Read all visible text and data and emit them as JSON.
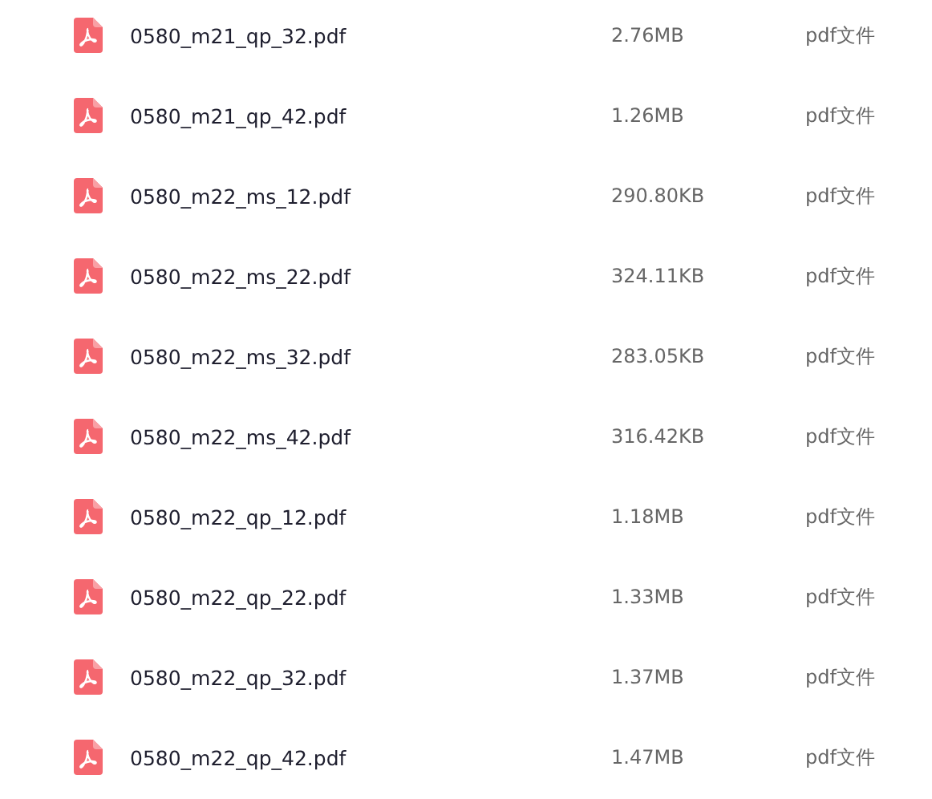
{
  "files": [
    {
      "name": "0580_m21_qp_32.pdf",
      "size": "2.76MB",
      "type": "pdf文件"
    },
    {
      "name": "0580_m21_qp_42.pdf",
      "size": "1.26MB",
      "type": "pdf文件"
    },
    {
      "name": "0580_m22_ms_12.pdf",
      "size": "290.80KB",
      "type": "pdf文件"
    },
    {
      "name": "0580_m22_ms_22.pdf",
      "size": "324.11KB",
      "type": "pdf文件"
    },
    {
      "name": "0580_m22_ms_32.pdf",
      "size": "283.05KB",
      "type": "pdf文件"
    },
    {
      "name": "0580_m22_ms_42.pdf",
      "size": "316.42KB",
      "type": "pdf文件"
    },
    {
      "name": "0580_m22_qp_12.pdf",
      "size": "1.18MB",
      "type": "pdf文件"
    },
    {
      "name": "0580_m22_qp_22.pdf",
      "size": "1.33MB",
      "type": "pdf文件"
    },
    {
      "name": "0580_m22_qp_32.pdf",
      "size": "1.37MB",
      "type": "pdf文件"
    },
    {
      "name": "0580_m22_qp_42.pdf",
      "size": "1.47MB",
      "type": "pdf文件"
    }
  ]
}
